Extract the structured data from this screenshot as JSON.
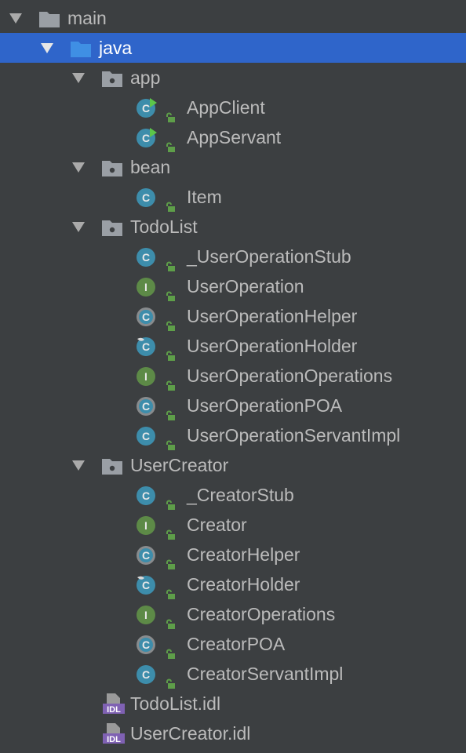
{
  "colors": {
    "background": "#3c3f41",
    "selection": "#2f65ca",
    "text": "#bbbbbb",
    "folder": "#9a9fa5",
    "source_folder": "#3f8fe4",
    "class_badge": "#3d8dab",
    "interface_badge": "#5d8a47",
    "lock_green": "#5e9e49",
    "idl_purple": "#7f61b3"
  },
  "tree": [
    {
      "label": "main",
      "kind": "folder",
      "depth": 0,
      "expanded": true,
      "selected": false
    },
    {
      "label": "java",
      "kind": "source-folder",
      "depth": 1,
      "expanded": true,
      "selected": true
    },
    {
      "label": "app",
      "kind": "package",
      "depth": 2,
      "expanded": true,
      "selected": false
    },
    {
      "label": "AppClient",
      "kind": "class-runnable",
      "depth": 3,
      "lock": true
    },
    {
      "label": "AppServant",
      "kind": "class-runnable",
      "depth": 3,
      "lock": true
    },
    {
      "label": "bean",
      "kind": "package",
      "depth": 2,
      "expanded": true,
      "selected": false
    },
    {
      "label": "Item",
      "kind": "class",
      "depth": 3,
      "lock": true
    },
    {
      "label": "TodoList",
      "kind": "package",
      "depth": 2,
      "expanded": true,
      "selected": false
    },
    {
      "label": "_UserOperationStub",
      "kind": "class",
      "depth": 3,
      "lock": true
    },
    {
      "label": "UserOperation",
      "kind": "interface",
      "depth": 3,
      "lock": true
    },
    {
      "label": "UserOperationHelper",
      "kind": "abstract-class",
      "depth": 3,
      "lock": true
    },
    {
      "label": "UserOperationHolder",
      "kind": "final-class",
      "depth": 3,
      "lock": true
    },
    {
      "label": "UserOperationOperations",
      "kind": "interface",
      "depth": 3,
      "lock": true
    },
    {
      "label": "UserOperationPOA",
      "kind": "abstract-class",
      "depth": 3,
      "lock": true
    },
    {
      "label": "UserOperationServantImpl",
      "kind": "class",
      "depth": 3,
      "lock": true
    },
    {
      "label": "UserCreator",
      "kind": "package",
      "depth": 2,
      "expanded": true,
      "selected": false
    },
    {
      "label": "_CreatorStub",
      "kind": "class",
      "depth": 3,
      "lock": true
    },
    {
      "label": "Creator",
      "kind": "interface",
      "depth": 3,
      "lock": true
    },
    {
      "label": "CreatorHelper",
      "kind": "abstract-class",
      "depth": 3,
      "lock": true
    },
    {
      "label": "CreatorHolder",
      "kind": "final-class",
      "depth": 3,
      "lock": true
    },
    {
      "label": "CreatorOperations",
      "kind": "interface",
      "depth": 3,
      "lock": true
    },
    {
      "label": "CreatorPOA",
      "kind": "abstract-class",
      "depth": 3,
      "lock": true
    },
    {
      "label": "CreatorServantImpl",
      "kind": "class",
      "depth": 3,
      "lock": true
    },
    {
      "label": "TodoList.idl",
      "kind": "idl-file",
      "depth": 2,
      "lock": false
    },
    {
      "label": "UserCreator.idl",
      "kind": "idl-file",
      "depth": 2,
      "lock": false
    }
  ]
}
